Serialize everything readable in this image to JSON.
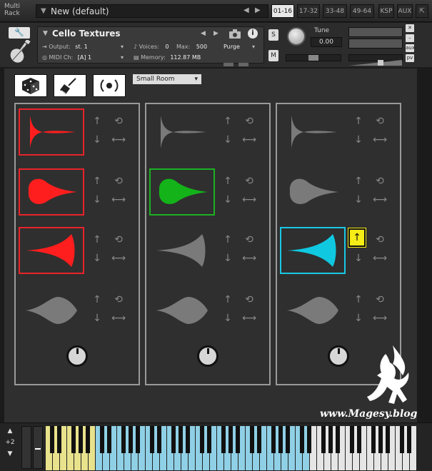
{
  "rack": {
    "label_line1": "Multi",
    "label_line2": "Rack",
    "preset_name": "New (default)",
    "tabs": [
      "01-16",
      "17-32",
      "33-48",
      "49-64",
      "KSP",
      "AUX"
    ],
    "active_tab": "01-16"
  },
  "instrument": {
    "name": "Cello Textures",
    "output_label": "Output:",
    "output_value": "st. 1",
    "midi_label": "MIDI Ch:",
    "midi_value": "[A] 1",
    "voices_label": "Voices:",
    "voices_value": "0",
    "max_label": "Max:",
    "max_value": "500",
    "memory_label": "Memory:",
    "memory_value": "112.87 MB",
    "purge_label": "Purge",
    "solo_label": "S",
    "mute_label": "M",
    "tune_label": "Tune",
    "tune_value": "0.00",
    "aux_label": "aux",
    "pv_label": "pv"
  },
  "controls": {
    "room_select": "Small Room"
  },
  "columns": [
    {
      "slots": [
        {
          "shape": "decay",
          "selected": "red"
        },
        {
          "shape": "leaf",
          "selected": "red"
        },
        {
          "shape": "swell",
          "selected": "red"
        },
        {
          "shape": "leaf-grey",
          "selected": "none"
        }
      ]
    },
    {
      "slots": [
        {
          "shape": "decay",
          "selected": "none"
        },
        {
          "shape": "leaf",
          "selected": "green"
        },
        {
          "shape": "swell",
          "selected": "none"
        },
        {
          "shape": "leaf-grey",
          "selected": "none"
        }
      ]
    },
    {
      "slots": [
        {
          "shape": "decay",
          "selected": "none"
        },
        {
          "shape": "leaf",
          "selected": "none"
        },
        {
          "shape": "swell",
          "selected": "cyan",
          "up_highlight": true
        },
        {
          "shape": "leaf-grey",
          "selected": "none"
        }
      ]
    }
  ],
  "colors": {
    "red": "#ff1e1e",
    "green": "#13b319",
    "cyan": "#10c8e0",
    "grey": "#7a7a7a",
    "yellow": "#f6ec16"
  },
  "icons": {
    "up": "↑",
    "down": "↓",
    "loop": "⟲",
    "stretch": "⟷"
  },
  "keyboard": {
    "transpose": "+2"
  },
  "watermark": {
    "text": "www.Magesy.blog"
  }
}
